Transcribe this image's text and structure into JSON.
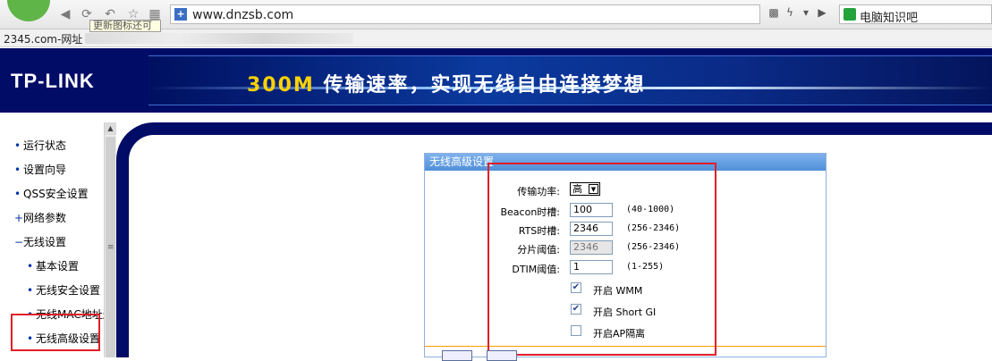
{
  "browser": {
    "url": "www.dnzsb.com",
    "search_text": "电脑知识吧",
    "bookmark": "2345.com-网址",
    "tooltip": "更新图标还可"
  },
  "router": {
    "brand": "TP-LINK",
    "banner_accent": "300M",
    "banner_text": "传输速率，实现无线自由连接梦想"
  },
  "sidebar": {
    "items": [
      {
        "label": "运行状态",
        "bullet": "•"
      },
      {
        "label": "设置向导",
        "bullet": "•"
      },
      {
        "label": "QSS安全设置",
        "bullet": "•"
      },
      {
        "label": "网络参数",
        "bullet": "+"
      },
      {
        "label": "无线设置",
        "bullet": "−"
      },
      {
        "label": "基本设置",
        "bullet": "•"
      },
      {
        "label": "无线安全设置",
        "bullet": "•"
      },
      {
        "label": "无线MAC地址过滤",
        "bullet": "•"
      },
      {
        "label": "无线高级设置",
        "bullet": "•"
      }
    ]
  },
  "panel": {
    "title": "无线高级设置",
    "power_label": "传输功率:",
    "power_value": "高",
    "beacon_label": "Beacon时槽:",
    "beacon_value": "100",
    "beacon_hint": "(40-1000)",
    "rts_label": "RTS时槽:",
    "rts_value": "2346",
    "rts_hint": "(256-2346)",
    "frag_label": "分片阈值:",
    "frag_value": "2346",
    "frag_hint": "(256-2346)",
    "dtim_label": "DTIM阈值:",
    "dtim_value": "1",
    "dtim_hint": "(1-255)",
    "wmm_label": "开启 WMM",
    "wmm_checked": true,
    "sgi_label": "开启 Short GI",
    "sgi_checked": true,
    "ap_label": "开启AP隔离",
    "ap_checked": false
  },
  "colors": {
    "header_bg": "#000c66",
    "highlight": "#e01e2a",
    "panel_title": "#4f8fd9"
  }
}
